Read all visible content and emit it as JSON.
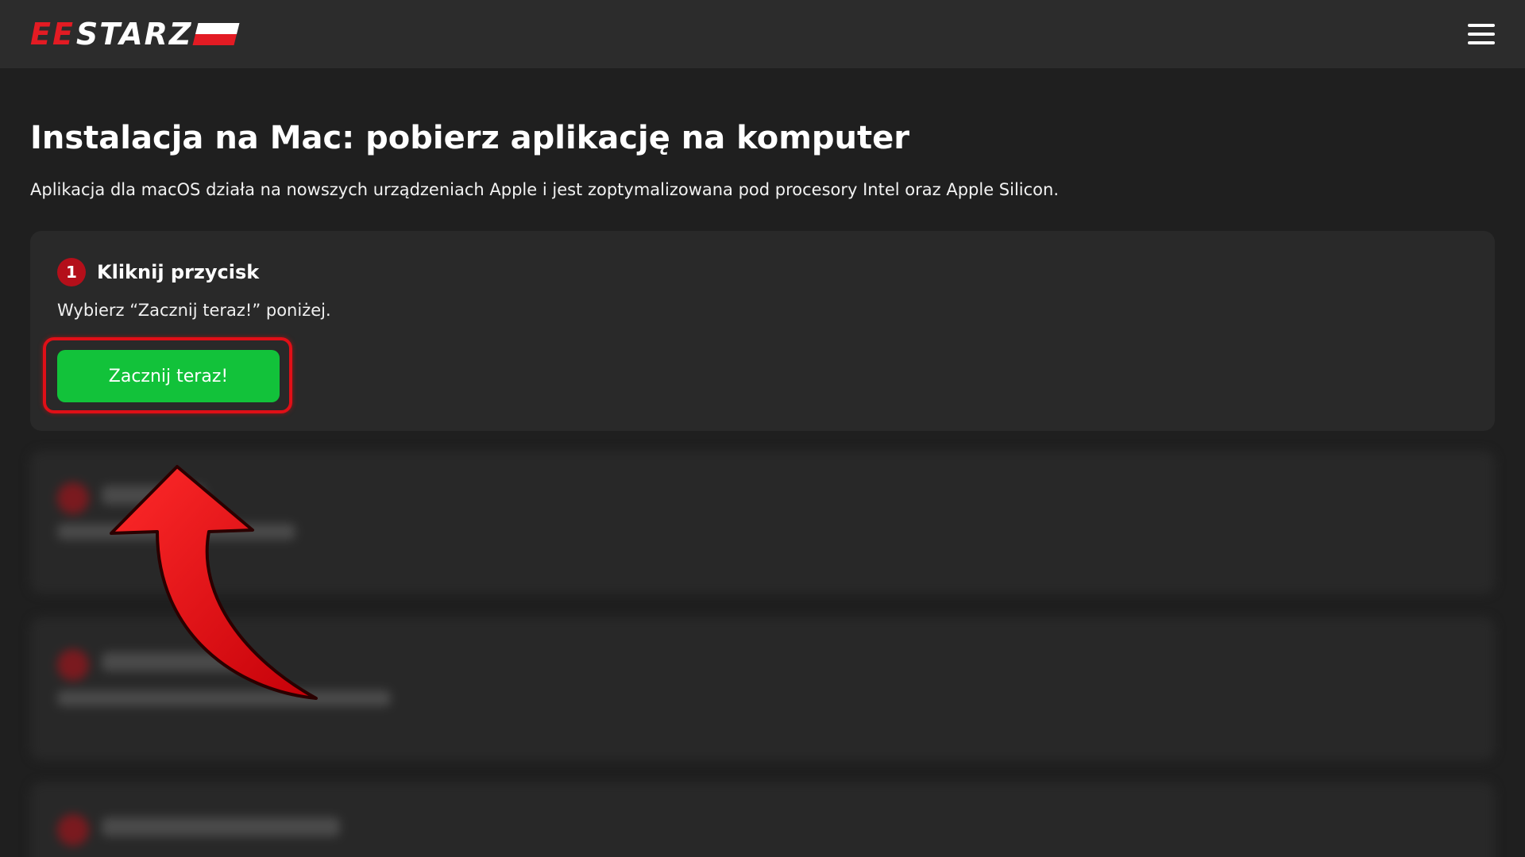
{
  "header": {
    "logo_prefix": "EE",
    "logo_text": "STARZ",
    "menu_icon": "hamburger-menu-icon"
  },
  "main": {
    "title": "Instalacja na Mac: pobierz aplikację na komputer",
    "subtitle": "Aplikacja dla macOS działa na nowszych urządzeniach Apple i jest zoptymalizowana pod procesory Intel oraz Apple Silicon."
  },
  "step1": {
    "number": "1",
    "title": "Kliknij przycisk",
    "description": "Wybierz “Zacznij teraz!” poniżej.",
    "button_label": "Zacznij teraz!"
  },
  "colors": {
    "background": "#1f1f1f",
    "header": "#2c2c2c",
    "card": "#292929",
    "accent_red": "#e31b23",
    "button_green": "#12c23a"
  }
}
